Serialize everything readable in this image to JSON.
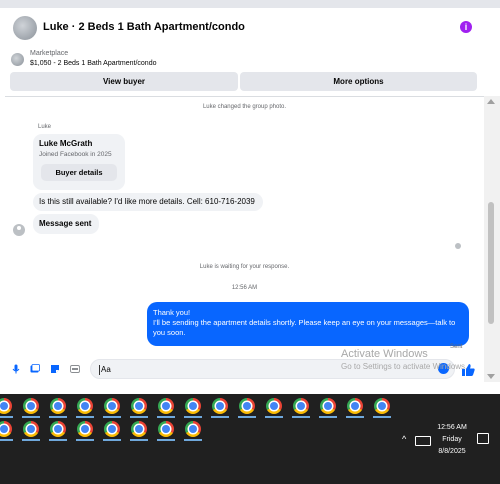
{
  "header": {
    "title": "Luke · 2 Beds 1 Bath Apartment/condo",
    "info_icon": "info-icon",
    "accent": "#a020f0"
  },
  "marketplace": {
    "label": "Marketplace",
    "listing": "$1,050 - 2 Beds 1 Bath Apartment/condo",
    "view_buyer": "View buyer",
    "more_options": "More options"
  },
  "chat": {
    "system_photo": "Luke changed the group photo.",
    "sender": "Luke",
    "card": {
      "name": "Luke McGrath",
      "joined": "Joined Facebook in 2025",
      "button": "Buyer details"
    },
    "msg_in_1": "Is this still available? I'd like more details. Cell: 610-716-2039",
    "msg_in_2": "Message sent",
    "waiting": "Luke is waiting for your response.",
    "time": "12:56 AM",
    "msg_out_line1": "Thank you!",
    "msg_out_line2": "I'll be sending the apartment details shortly. Please keep an eye on your messages—talk to you soon.",
    "status": "Sent",
    "outgoing_color": "#0866ff"
  },
  "composer": {
    "placeholder": "Aa"
  },
  "watermark": {
    "line1": "Activate Windows",
    "line2": "Go to Settings to activate Windows."
  },
  "taskbar": {
    "time": "12:56 AM",
    "day": "Friday",
    "date": "8/8/2025",
    "app_icon": "chrome-icon",
    "row1_count": 15,
    "row2_count": 8
  }
}
